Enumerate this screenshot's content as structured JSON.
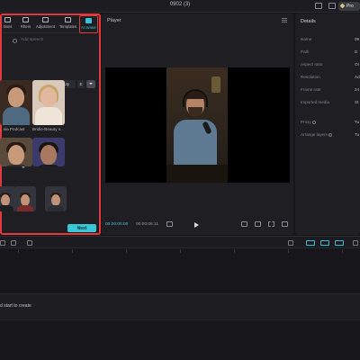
{
  "window": {
    "title": "0902 (3)",
    "plan_badge": "Pro"
  },
  "toolbar": {
    "tools": [
      {
        "label": "Transitions",
        "visible_text": "itions"
      },
      {
        "label": "Filters"
      },
      {
        "label": "Adjustment"
      },
      {
        "label": "Templates"
      },
      {
        "label": "AI avatar",
        "active": true
      }
    ]
  },
  "search": {
    "placeholder": "Add speech"
  },
  "categories": [
    {
      "label": "ding",
      "selected": true
    },
    {
      "label": "Marketing"
    },
    {
      "label": "Beauty"
    },
    {
      "label": "E"
    }
  ],
  "avatars": [
    {
      "label": "...sia Podcast"
    },
    {
      "label": "Bridie-Beauty s..."
    }
  ],
  "left_panel": {
    "next_label": "Next"
  },
  "player": {
    "title": "Player",
    "time_current": "00:00:00:00",
    "time_total": "00:00:06:11"
  },
  "details": {
    "title": "Details",
    "rows": [
      {
        "label": "Name",
        "value": "09"
      },
      {
        "label": "Path",
        "value": "D"
      },
      {
        "label": "Aspect ratio",
        "value": "Or"
      },
      {
        "label": "Resolution",
        "value": "Ad"
      },
      {
        "label": "Frame rate",
        "value": "24"
      },
      {
        "label": "Imported media",
        "value": "St"
      },
      {
        "label": "Proxy",
        "value": "Tu",
        "help": true
      },
      {
        "label": "Arrange layers",
        "value": "Tu",
        "help": true
      }
    ]
  },
  "timeline": {
    "hint": "d start to create"
  },
  "colors": {
    "accent": "#38c7d9",
    "highlight": "#e3383c",
    "bg": "#17171b",
    "panel": "#1e1e23"
  }
}
